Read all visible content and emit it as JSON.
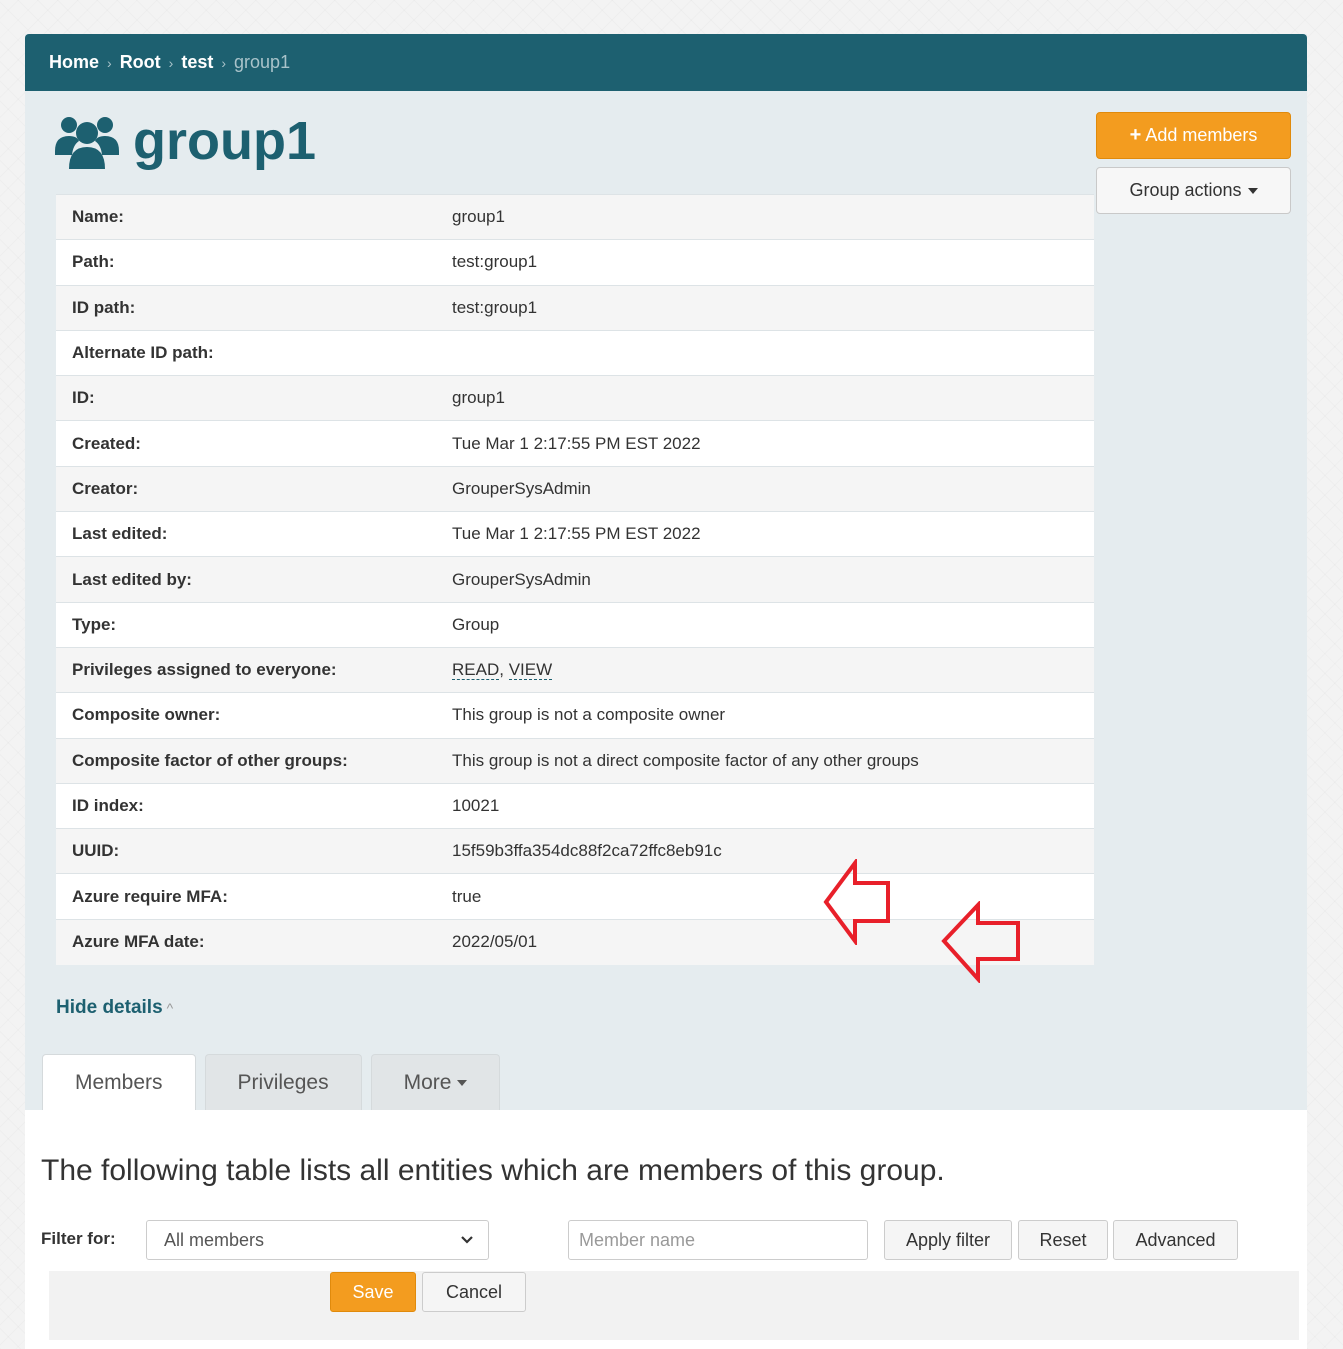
{
  "breadcrumb": {
    "home": "Home",
    "root": "Root",
    "folder": "test",
    "current": "group1"
  },
  "header": {
    "title": "group1",
    "title_icon": "users-icon",
    "add_members_label": "Add members",
    "group_actions_label": "Group actions"
  },
  "details": {
    "rows": [
      {
        "label": "Name:",
        "value": "group1"
      },
      {
        "label": "Path:",
        "value": "test:group1"
      },
      {
        "label": "ID path:",
        "value": "test:group1"
      },
      {
        "label": "Alternate ID path:",
        "value": ""
      },
      {
        "label": "ID:",
        "value": "group1"
      },
      {
        "label": "Created:",
        "value": "Tue Mar 1 2:17:55 PM EST 2022"
      },
      {
        "label": "Creator:",
        "value": "GrouperSysAdmin"
      },
      {
        "label": "Last edited:",
        "value": "Tue Mar 1 2:17:55 PM EST 2022"
      },
      {
        "label": "Last edited by:",
        "value": "GrouperSysAdmin"
      },
      {
        "label": "Type:",
        "value": "Group"
      },
      {
        "label": "Privileges assigned to everyone:",
        "value": ""
      },
      {
        "label": "Composite owner:",
        "value": "This group is not a composite owner"
      },
      {
        "label": "Composite factor of other groups:",
        "value": "This group is not a direct composite factor of any other groups"
      },
      {
        "label": "ID index:",
        "value": "10021"
      },
      {
        "label": "UUID:",
        "value": "15f59b3ffa354dc88f2ca72ffc8eb91c"
      },
      {
        "label": "Azure require MFA:",
        "value": "true"
      },
      {
        "label": "Azure MFA date:",
        "value": "2022/05/01"
      }
    ],
    "privileges": {
      "read": "READ",
      "separator": ",",
      "view": "VIEW"
    },
    "hide_label": "Hide details",
    "hide_chevron": "^"
  },
  "tabs": [
    {
      "label": "Members",
      "active": true
    },
    {
      "label": "Privileges",
      "active": false
    },
    {
      "label": "More",
      "active": false
    }
  ],
  "members": {
    "intro": "The following table lists all entities which are members of this group.",
    "filter_label": "Filter for:",
    "filter_selected": "All members",
    "member_name_placeholder": "Member name",
    "apply_filter_label": "Apply filter",
    "reset_label": "Reset",
    "advanced_label": "Advanced"
  },
  "footer": {
    "save_label": "Save",
    "cancel_label": "Cancel"
  },
  "colors": {
    "brand": "#1d6070",
    "accent": "#f39c1f",
    "annotation_arrow": "#e8202a"
  }
}
